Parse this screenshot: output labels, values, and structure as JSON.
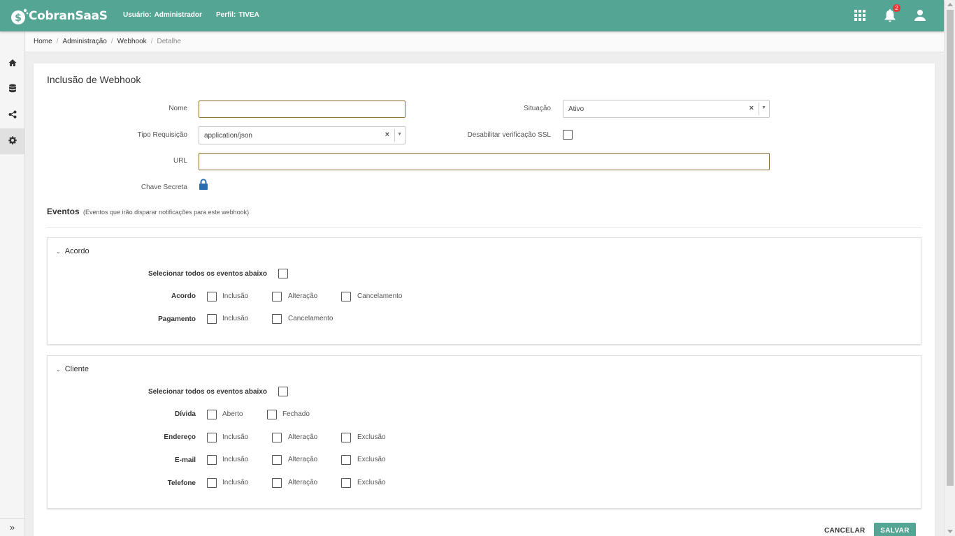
{
  "header": {
    "brand": "CobranSaaS",
    "user_label": "Usuário:",
    "user_value": "Administrador",
    "profile_label": "Perfil:",
    "profile_value": "TIVEA",
    "apps_icon": "grid-icon",
    "notifications_icon": "bell-icon",
    "notifications_count": "2",
    "user_icon": "person-icon",
    "bg_color": "#55a594"
  },
  "sidebar": {
    "items": [
      {
        "icon": "home-icon"
      },
      {
        "icon": "database-icon"
      },
      {
        "icon": "share-icon"
      },
      {
        "icon": "gear-icon",
        "active": true
      }
    ],
    "expand_label": "»"
  },
  "breadcrumb": {
    "items": [
      "Home",
      "Administração",
      "Webhook"
    ],
    "current": "Detalhe"
  },
  "form": {
    "title": "Inclusão de Webhook",
    "nome_label": "Nome",
    "nome_value": "",
    "situacao_label": "Situação",
    "situacao_value": "Ativo",
    "tipo_label": "Tipo Requisição",
    "tipo_value": "application/json",
    "ssl_label": "Desabilitar verificação SSL",
    "url_label": "URL",
    "url_value": "",
    "chave_label": "Chave Secreta",
    "chave_icon": "lock-icon"
  },
  "eventos": {
    "title": "Eventos",
    "subtitle": "(Eventos que irão disparar notificações para este webhook)",
    "select_all_label": "Selecionar todos os eventos abaixo",
    "groups": [
      {
        "name": "Acordo",
        "rows": [
          {
            "label": "Acordo",
            "options": [
              "Inclusão",
              "Alteração",
              "Cancelamento"
            ]
          },
          {
            "label": "Pagamento",
            "options": [
              "Inclusão",
              "Cancelamento"
            ]
          }
        ]
      },
      {
        "name": "Cliente",
        "rows": [
          {
            "label": "Dívida",
            "options": [
              "Aberto",
              "Fechado"
            ]
          },
          {
            "label": "Endereço",
            "options": [
              "Inclusão",
              "Alteração",
              "Exclusão"
            ]
          },
          {
            "label": "E-mail",
            "options": [
              "Inclusão",
              "Alteração",
              "Exclusão"
            ]
          },
          {
            "label": "Telefone",
            "options": [
              "Inclusão",
              "Alteração",
              "Exclusão"
            ]
          }
        ]
      }
    ]
  },
  "actions": {
    "cancel": "CANCELAR",
    "save": "SALVAR"
  }
}
